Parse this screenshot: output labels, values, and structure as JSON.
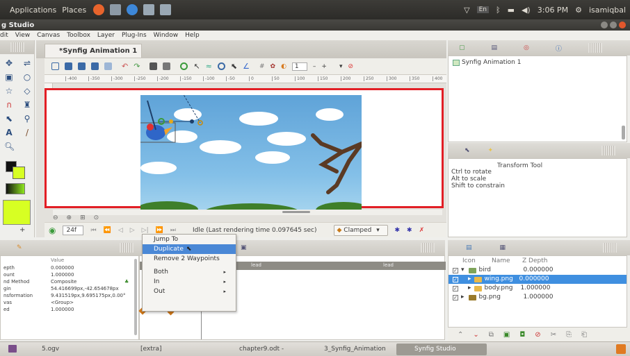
{
  "system_bar": {
    "applications": "Applications",
    "places": "Places",
    "keyboard": "En",
    "time": "3:06 PM",
    "user": "isamiqbal"
  },
  "window": {
    "title": "g Studio"
  },
  "menu": [
    "dit",
    "View",
    "Canvas",
    "Toolbox",
    "Layer",
    "Plug-Ins",
    "Window",
    "Help"
  ],
  "document": {
    "tab_label": "*Synfig Animation 1",
    "tab_close": "⌘",
    "frame_field": "1",
    "ruler_ticks": [
      "-400",
      "-350",
      "-300",
      "-250",
      "-200",
      "-150",
      "-100",
      "-50",
      "0",
      "50",
      "100",
      "150",
      "200",
      "250",
      "300",
      "350",
      "400"
    ]
  },
  "framebar": {
    "current_frame": "24f",
    "status": "Idle (Last rendering time 0.097645 sec)",
    "interpolation": "Clamped"
  },
  "canvas_browser": {
    "item": "Synfig Animation 1"
  },
  "tool_options": {
    "title": "Transform Tool",
    "lines": [
      "Ctrl to rotate",
      "Alt to scale",
      "Shift to constrain"
    ]
  },
  "params": {
    "header_value": "Value",
    "rows": [
      {
        "name": "epth",
        "value": "0.000000"
      },
      {
        "name": "ount",
        "value": "1.000000"
      },
      {
        "name": "nd Method",
        "value": "Composite"
      },
      {
        "name": "gin",
        "value": "54.416699px,-42.654678px"
      },
      {
        "name": "nsformation",
        "value": "9.431519px,9.695175px,0.00°"
      },
      {
        "name": "vas",
        "value": "<Group>"
      },
      {
        "name": "ed",
        "value": "1.000000"
      }
    ]
  },
  "timetrack": {
    "label_a": "lead",
    "label_b": "lead"
  },
  "context_menu": {
    "items": [
      "Jump To",
      "Duplicate",
      "Remove 2 Waypoints",
      "Both",
      "In",
      "Out"
    ]
  },
  "layers": {
    "head_icon": "Icon",
    "head_name": "Name",
    "head_zdepth": "Z Depth",
    "rows": [
      {
        "name": "bird",
        "z": "0.000000",
        "selected": false
      },
      {
        "name": "wing.png",
        "z": "0.000000",
        "selected": true
      },
      {
        "name": "body.png",
        "z": "1.000000",
        "selected": false
      },
      {
        "name": "bg.png",
        "z": "1.000000",
        "selected": false
      }
    ]
  },
  "taskbar": {
    "items": [
      "5.ogv",
      "[extra]",
      "chapter9.odt - Libre...",
      "3_Synfig_Animation",
      "Synfig Studio"
    ]
  }
}
